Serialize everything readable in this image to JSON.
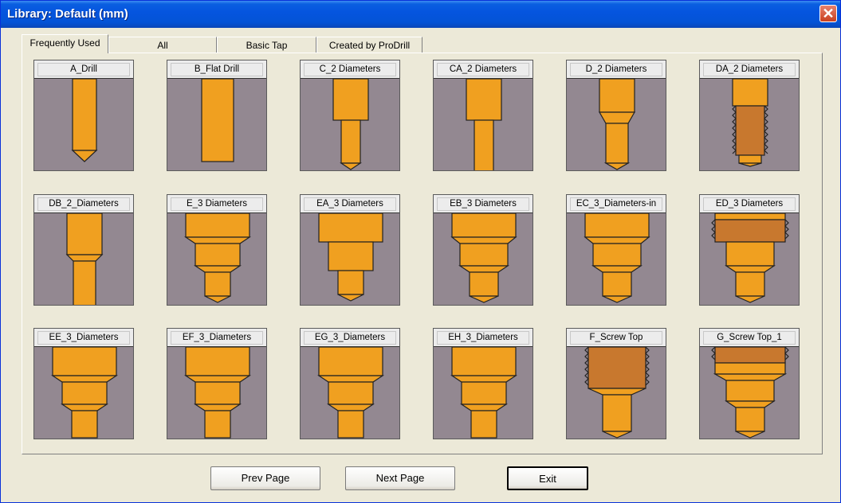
{
  "window": {
    "title": "Library: Default (mm)"
  },
  "tabs": [
    {
      "label": "Frequently Used",
      "active": true
    },
    {
      "label": "All",
      "active": false
    },
    {
      "label": "Basic Tap",
      "active": false
    },
    {
      "label": "Created by ProDrill",
      "active": false
    }
  ],
  "tools": [
    {
      "label": "A_Drill",
      "shape": "drill"
    },
    {
      "label": "B_Flat Drill",
      "shape": "flat-drill"
    },
    {
      "label": "C_2 Diameters",
      "shape": "two-diameter"
    },
    {
      "label": "CA_2 Diameters",
      "shape": "two-diameter-flat"
    },
    {
      "label": "D_2 Diameters",
      "shape": "two-diameter-chamfer"
    },
    {
      "label": "DA_2 Diameters",
      "shape": "two-diameter-thread"
    },
    {
      "label": "DB_2_Diameters",
      "shape": "two-diameter-flat-chamfer"
    },
    {
      "label": "E_3 Diameters",
      "shape": "three-diameter"
    },
    {
      "label": "EA_3 Diameters",
      "shape": "three-diameter-step"
    },
    {
      "label": "EB_3 Diameters",
      "shape": "three-diameter-chamfer"
    },
    {
      "label": "EC_3_Diameters-in",
      "shape": "three-diameter-chamfer"
    },
    {
      "label": "ED_3 Diameters",
      "shape": "three-diameter-thread"
    },
    {
      "label": "EE_3_Diameters",
      "shape": "three-diameter-flat"
    },
    {
      "label": "EF_3_Diameters",
      "shape": "three-diameter-flat"
    },
    {
      "label": "EG_3_Diameters",
      "shape": "three-diameter-flat"
    },
    {
      "label": "EH_3_Diameters",
      "shape": "three-diameter-flat"
    },
    {
      "label": "F_Screw Top",
      "shape": "screw-top"
    },
    {
      "label": "G_Screw Top_1",
      "shape": "screw-top-three"
    }
  ],
  "buttons": {
    "prev": "Prev Page",
    "next": "Next Page",
    "exit": "Exit"
  },
  "colors": {
    "tool": "#f0a020",
    "thread": "#c8782e",
    "cell_bg": "#938891",
    "titlebar": "#0555df"
  }
}
